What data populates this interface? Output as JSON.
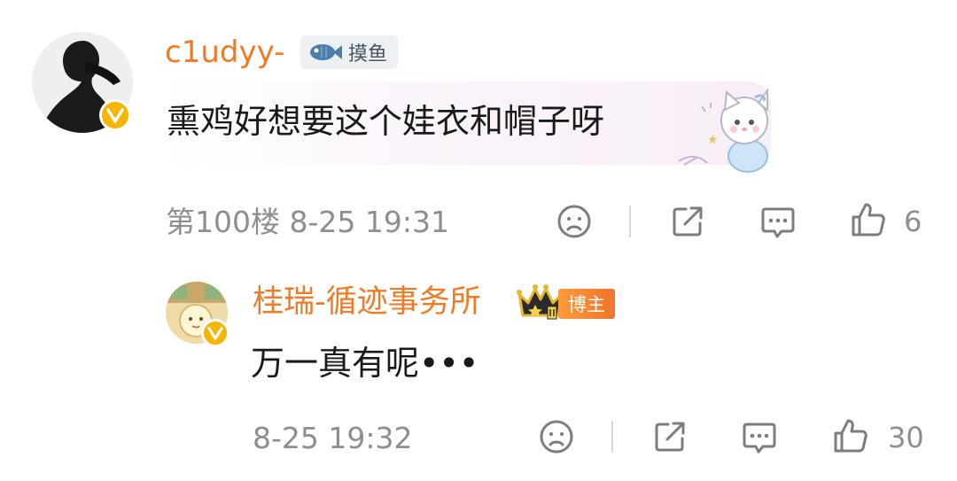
{
  "comment": {
    "username": "c1udyy-",
    "tag_label": "摸鱼",
    "text": "熏鸡好想要这个娃衣和帽子呀",
    "floor_time": "第100楼 8-25 19:31",
    "like_count": "6"
  },
  "reply": {
    "username": "桂瑞-循迹事务所",
    "badge_label": "博主",
    "text": "万一真有呢•••",
    "time": "8-25 19:32",
    "like_count": "30"
  },
  "colors": {
    "username": "#f07a26",
    "verified_badge": "#f7b500",
    "blogger_badge": "#f0742a",
    "meta_text": "#8e8e8e"
  },
  "icons": {
    "avatar_badge": "verified-v-icon",
    "tag": "fish-icon",
    "level_badge": "crown-icon",
    "actions": [
      "dislike-face-icon",
      "share-icon",
      "comment-icon",
      "like-thumb-icon"
    ]
  }
}
